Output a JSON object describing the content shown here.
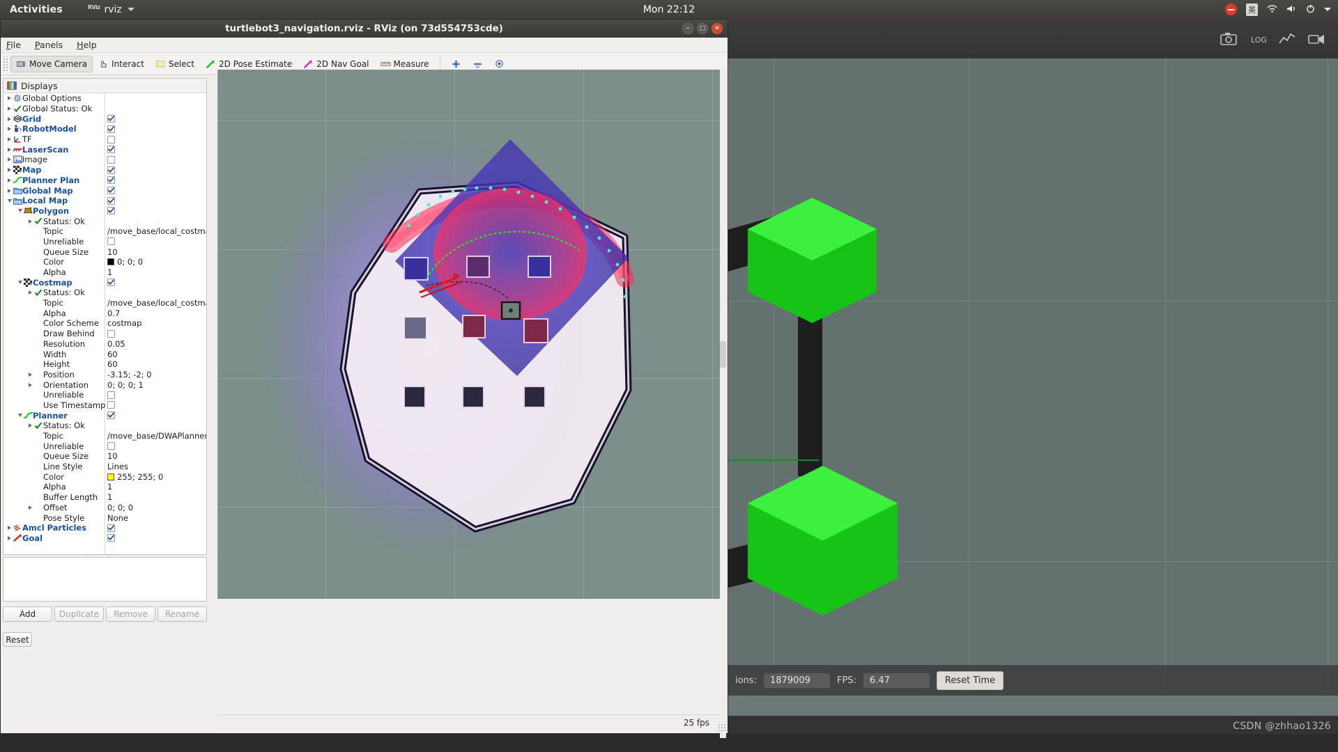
{
  "desktop": {
    "activities": "Activities",
    "app_name": "rviz",
    "app_logo": "RViz",
    "clock": "Mon 22:12",
    "tray": [
      {
        "name": "notification-blocked-icon",
        "glyph": "—"
      },
      {
        "name": "input-method-icon",
        "glyph": "英"
      },
      {
        "name": "wifi-icon",
        "glyph": "▲"
      },
      {
        "name": "volume-icon",
        "glyph": "🔊"
      },
      {
        "name": "power-icon",
        "glyph": "⏻"
      },
      {
        "name": "chevron-down-icon",
        "glyph": "▾"
      }
    ]
  },
  "rviz": {
    "title": "turtlebot3_navigation.rviz - RViz (on 73d554753cde)",
    "window_buttons": [
      {
        "name": "minimize-button",
        "glyph": "–"
      },
      {
        "name": "maximize-button",
        "glyph": "□"
      },
      {
        "name": "close-button",
        "glyph": "✕"
      }
    ],
    "menu": [
      {
        "label": "File",
        "mnemonic": "F"
      },
      {
        "label": "Panels",
        "mnemonic": "P"
      },
      {
        "label": "Help",
        "mnemonic": "H"
      }
    ],
    "toolbar": [
      {
        "label": "Move Camera",
        "icon": "move-camera-icon",
        "active": true
      },
      {
        "label": "Interact",
        "icon": "interact-hand-icon",
        "active": false
      },
      {
        "label": "Select",
        "icon": "select-rect-icon",
        "active": false
      },
      {
        "label": "2D Pose Estimate",
        "icon": "pose-estimate-arrow-icon",
        "active": false
      },
      {
        "label": "2D Nav Goal",
        "icon": "nav-goal-arrow-icon",
        "active": false
      },
      {
        "label": "Measure",
        "icon": "measure-ruler-icon",
        "active": false
      }
    ],
    "toolbar_extra": [
      {
        "name": "focus-camera-icon",
        "glyph": "✚"
      },
      {
        "name": "minus-tool-icon",
        "glyph": "➖"
      },
      {
        "name": "publish-point-icon",
        "glyph": "◉"
      }
    ],
    "displays_panel": {
      "title": "Displays",
      "buttons": [
        {
          "label": "Add",
          "enabled": true
        },
        {
          "label": "Duplicate",
          "enabled": false
        },
        {
          "label": "Remove",
          "enabled": false
        },
        {
          "label": "Rename",
          "enabled": false
        }
      ],
      "reset_button": "Reset"
    },
    "status": {
      "fps": "25 fps"
    },
    "tree": [
      {
        "indent": 0,
        "twist": "right",
        "icon": "gear-icon",
        "label": "Global Options",
        "bold": false,
        "value_type": "none"
      },
      {
        "indent": 0,
        "twist": "right",
        "icon": "status-ok-icon",
        "label": "Global Status: Ok",
        "bold": false,
        "value_type": "none"
      },
      {
        "indent": 0,
        "twist": "right",
        "icon": "grid-icon",
        "label": "Grid",
        "bold": true,
        "value_type": "check",
        "checked": true
      },
      {
        "indent": 0,
        "twist": "right",
        "icon": "robot-model-icon",
        "label": "RobotModel",
        "bold": true,
        "value_type": "check",
        "checked": true
      },
      {
        "indent": 0,
        "twist": "right",
        "icon": "tf-axes-icon",
        "label": "TF",
        "bold": false,
        "value_type": "check",
        "checked": false
      },
      {
        "indent": 0,
        "twist": "right",
        "icon": "laserscan-icon",
        "label": "LaserScan",
        "bold": true,
        "value_type": "check",
        "checked": true
      },
      {
        "indent": 0,
        "twist": "right",
        "icon": "image-icon",
        "label": "Image",
        "bold": false,
        "value_type": "check",
        "checked": false
      },
      {
        "indent": 0,
        "twist": "right",
        "icon": "map-icon",
        "label": "Map",
        "bold": true,
        "value_type": "check",
        "checked": true
      },
      {
        "indent": 0,
        "twist": "right",
        "icon": "path-icon",
        "label": "Planner Plan",
        "bold": true,
        "value_type": "check",
        "checked": true
      },
      {
        "indent": 0,
        "twist": "right",
        "icon": "folder-icon",
        "label": "Global Map",
        "bold": true,
        "value_type": "check",
        "checked": true
      },
      {
        "indent": 0,
        "twist": "down",
        "icon": "folder-icon",
        "label": "Local Map",
        "bold": true,
        "value_type": "check",
        "checked": true
      },
      {
        "indent": 1,
        "twist": "down",
        "icon": "polygon-icon",
        "label": "Polygon",
        "bold": true,
        "value_type": "check",
        "checked": true
      },
      {
        "indent": 2,
        "twist": "right",
        "icon": "status-ok-icon",
        "label": "Status: Ok",
        "bold": false,
        "value_type": "none"
      },
      {
        "indent": 2,
        "twist": "none",
        "icon": "none",
        "label": "Topic",
        "bold": false,
        "value_type": "text",
        "value": "/move_base/local_costmap..."
      },
      {
        "indent": 2,
        "twist": "none",
        "icon": "none",
        "label": "Unreliable",
        "bold": false,
        "value_type": "check",
        "checked": false
      },
      {
        "indent": 2,
        "twist": "none",
        "icon": "none",
        "label": "Queue Size",
        "bold": false,
        "value_type": "text",
        "value": "10"
      },
      {
        "indent": 2,
        "twist": "none",
        "icon": "none",
        "label": "Color",
        "bold": false,
        "value_type": "color",
        "value": "0; 0; 0",
        "color": "#000000"
      },
      {
        "indent": 2,
        "twist": "none",
        "icon": "none",
        "label": "Alpha",
        "bold": false,
        "value_type": "text",
        "value": "1"
      },
      {
        "indent": 1,
        "twist": "down",
        "icon": "map-icon",
        "label": "Costmap",
        "bold": true,
        "value_type": "check",
        "checked": true
      },
      {
        "indent": 2,
        "twist": "right",
        "icon": "status-ok-icon",
        "label": "Status: Ok",
        "bold": false,
        "value_type": "none"
      },
      {
        "indent": 2,
        "twist": "none",
        "icon": "none",
        "label": "Topic",
        "bold": false,
        "value_type": "text",
        "value": "/move_base/local_costmap..."
      },
      {
        "indent": 2,
        "twist": "none",
        "icon": "none",
        "label": "Alpha",
        "bold": false,
        "value_type": "text",
        "value": "0.7"
      },
      {
        "indent": 2,
        "twist": "none",
        "icon": "none",
        "label": "Color Scheme",
        "bold": false,
        "value_type": "text",
        "value": "costmap"
      },
      {
        "indent": 2,
        "twist": "none",
        "icon": "none",
        "label": "Draw Behind",
        "bold": false,
        "value_type": "check",
        "checked": false
      },
      {
        "indent": 2,
        "twist": "none",
        "icon": "none",
        "label": "Resolution",
        "bold": false,
        "value_type": "text",
        "value": "0.05"
      },
      {
        "indent": 2,
        "twist": "none",
        "icon": "none",
        "label": "Width",
        "bold": false,
        "value_type": "text",
        "value": "60"
      },
      {
        "indent": 2,
        "twist": "none",
        "icon": "none",
        "label": "Height",
        "bold": false,
        "value_type": "text",
        "value": "60"
      },
      {
        "indent": 2,
        "twist": "right",
        "icon": "none",
        "label": "Position",
        "bold": false,
        "value_type": "text",
        "value": "-3.15; -2; 0"
      },
      {
        "indent": 2,
        "twist": "right",
        "icon": "none",
        "label": "Orientation",
        "bold": false,
        "value_type": "text",
        "value": "0; 0; 0; 1"
      },
      {
        "indent": 2,
        "twist": "none",
        "icon": "none",
        "label": "Unreliable",
        "bold": false,
        "value_type": "check",
        "checked": false
      },
      {
        "indent": 2,
        "twist": "none",
        "icon": "none",
        "label": "Use Timestamp",
        "bold": false,
        "value_type": "check",
        "checked": false
      },
      {
        "indent": 1,
        "twist": "down",
        "icon": "path-icon",
        "label": "Planner",
        "bold": true,
        "value_type": "check",
        "checked": true
      },
      {
        "indent": 2,
        "twist": "right",
        "icon": "status-ok-icon",
        "label": "Status: Ok",
        "bold": false,
        "value_type": "none"
      },
      {
        "indent": 2,
        "twist": "none",
        "icon": "none",
        "label": "Topic",
        "bold": false,
        "value_type": "text",
        "value": "/move_base/DWAPlannerR..."
      },
      {
        "indent": 2,
        "twist": "none",
        "icon": "none",
        "label": "Unreliable",
        "bold": false,
        "value_type": "check",
        "checked": false
      },
      {
        "indent": 2,
        "twist": "none",
        "icon": "none",
        "label": "Queue Size",
        "bold": false,
        "value_type": "text",
        "value": "10"
      },
      {
        "indent": 2,
        "twist": "none",
        "icon": "none",
        "label": "Line Style",
        "bold": false,
        "value_type": "text",
        "value": "Lines"
      },
      {
        "indent": 2,
        "twist": "none",
        "icon": "none",
        "label": "Color",
        "bold": false,
        "value_type": "color",
        "value": "255; 255; 0",
        "color": "#ffff00"
      },
      {
        "indent": 2,
        "twist": "none",
        "icon": "none",
        "label": "Alpha",
        "bold": false,
        "value_type": "text",
        "value": "1"
      },
      {
        "indent": 2,
        "twist": "none",
        "icon": "none",
        "label": "Buffer Length",
        "bold": false,
        "value_type": "text",
        "value": "1"
      },
      {
        "indent": 2,
        "twist": "right",
        "icon": "none",
        "label": "Offset",
        "bold": false,
        "value_type": "text",
        "value": "0; 0; 0"
      },
      {
        "indent": 2,
        "twist": "none",
        "icon": "none",
        "label": "Pose Style",
        "bold": false,
        "value_type": "text",
        "value": "None"
      },
      {
        "indent": 0,
        "twist": "right",
        "icon": "particles-icon",
        "label": "Amcl Particles",
        "bold": true,
        "value_type": "check",
        "checked": true
      },
      {
        "indent": 0,
        "twist": "right",
        "icon": "goal-arrow-icon",
        "label": "Goal",
        "bold": true,
        "value_type": "check",
        "checked": true
      }
    ]
  },
  "gazebo": {
    "toolbar_icons": [
      {
        "name": "camera-icon"
      },
      {
        "name": "log-icon"
      },
      {
        "name": "plot-icon"
      },
      {
        "name": "video-icon"
      }
    ],
    "status": {
      "iterations_label": "ions:",
      "iterations_value": "1879009",
      "fps_label": "FPS:",
      "fps_value": "6.47",
      "reset_time_button": "Reset Time"
    }
  },
  "watermark": "CSDN @zhhao1326"
}
